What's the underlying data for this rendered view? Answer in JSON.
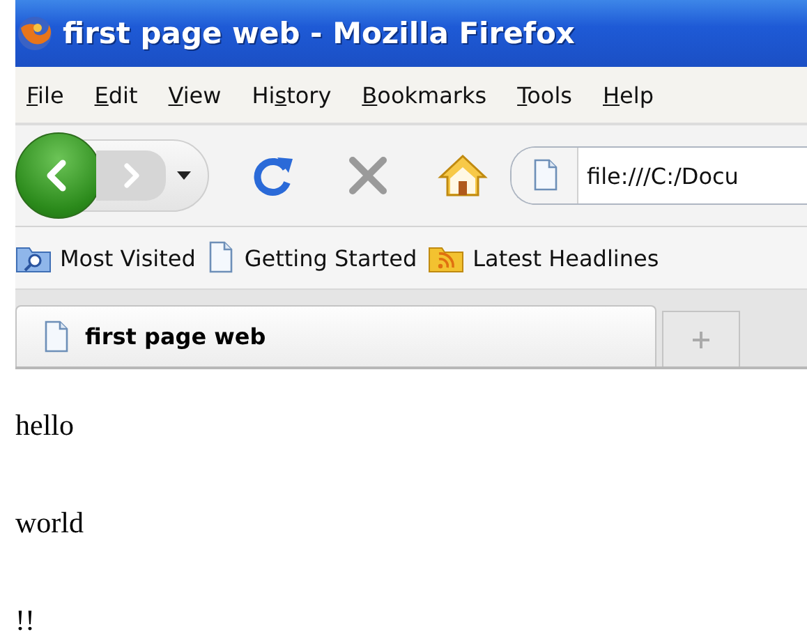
{
  "window": {
    "title": "first page web - Mozilla Firefox"
  },
  "menu": [
    {
      "access_key": "F",
      "rest": "ile"
    },
    {
      "access_key": "E",
      "rest": "dit"
    },
    {
      "access_key": "V",
      "rest": "iew"
    },
    {
      "before": "Hi",
      "access_key": "s",
      "rest": "tory"
    },
    {
      "access_key": "B",
      "rest": "ookmarks"
    },
    {
      "access_key": "T",
      "rest": "ools"
    },
    {
      "access_key": "H",
      "rest": "elp"
    }
  ],
  "navigation": {
    "back_enabled": true,
    "forward_enabled": false,
    "address": "file:///C:/Docu"
  },
  "bookmarks": [
    {
      "label": "Most Visited",
      "kind": "folder"
    },
    {
      "label": "Getting Started",
      "kind": "page"
    },
    {
      "label": "Latest Headlines",
      "kind": "feed"
    }
  ],
  "tabs": [
    {
      "label": "first page web",
      "selected": true
    }
  ],
  "content": {
    "paragraphs": [
      "hello",
      "world",
      "!!"
    ]
  }
}
